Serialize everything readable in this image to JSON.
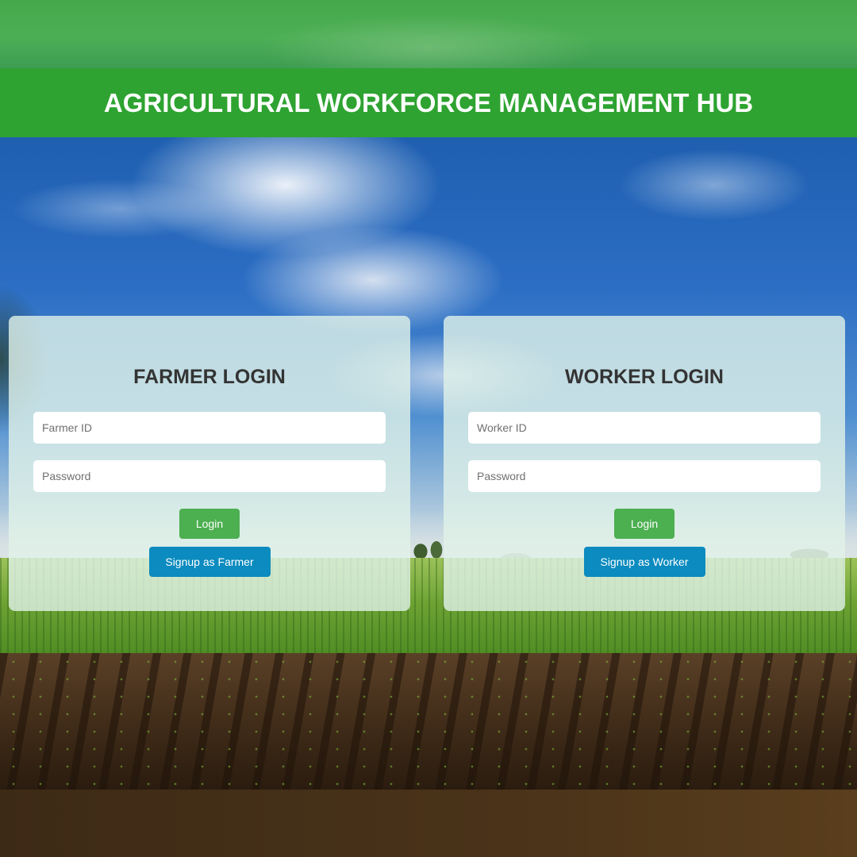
{
  "header": {
    "title": "AGRICULTURAL WORKFORCE MANAGEMENT HUB"
  },
  "farmer_login": {
    "title": "FARMER LOGIN",
    "id_placeholder": "Farmer ID",
    "password_placeholder": "Password",
    "login_label": "Login",
    "signup_label": "Signup as Farmer"
  },
  "worker_login": {
    "title": "WORKER LOGIN",
    "id_placeholder": "Worker ID",
    "password_placeholder": "Password",
    "login_label": "Login",
    "signup_label": "Signup as Worker"
  },
  "colors": {
    "header_green": "#2ea331",
    "login_button": "#4caf50",
    "signup_button": "#0b8bbf"
  }
}
